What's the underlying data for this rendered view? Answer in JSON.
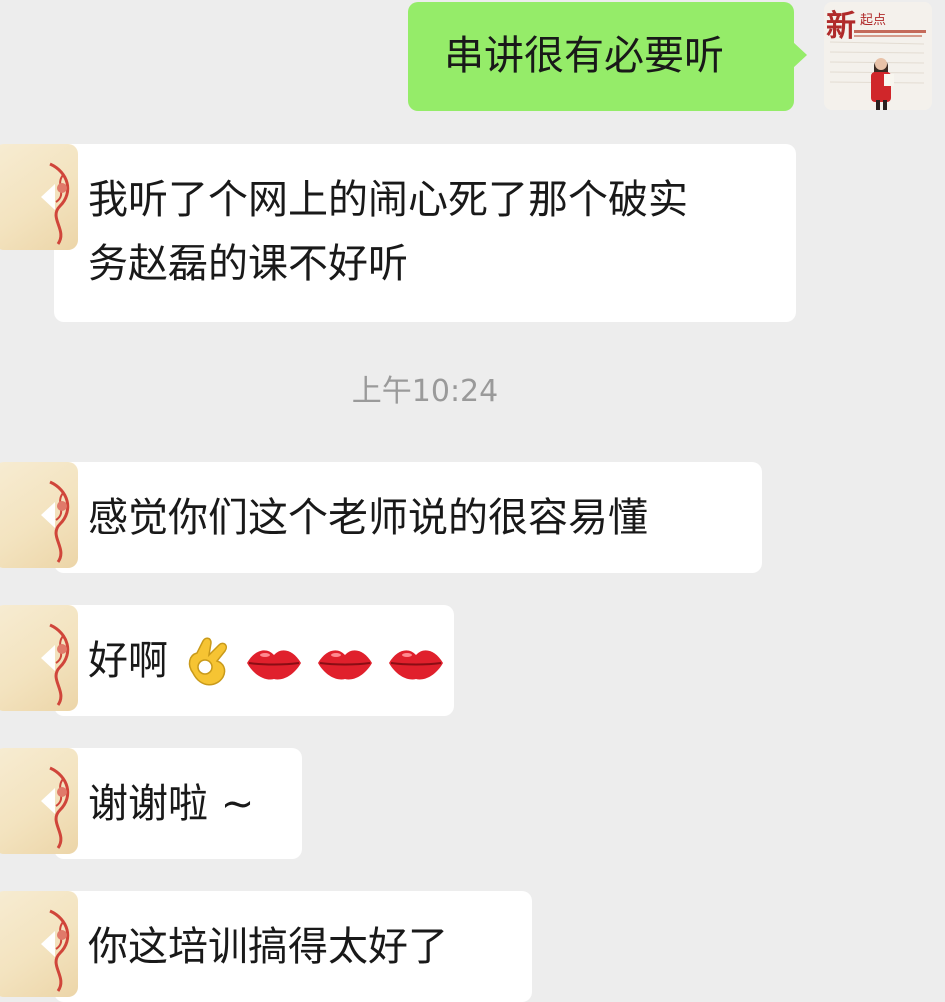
{
  "conversation": {
    "timestamp": "上午10:24",
    "messages": [
      {
        "sender": "self",
        "text": "串讲很有必要听"
      },
      {
        "sender": "contact",
        "text": "我听了个网上的闹心死了那个破实\n务赵磊的课不好听"
      },
      {
        "sender": "contact",
        "text": "感觉你们这个老师说的很容易懂"
      },
      {
        "sender": "contact",
        "text": "好啊",
        "emojis": [
          "ok-hand-emoji",
          "lips-emoji",
          "lips-emoji",
          "lips-emoji"
        ]
      },
      {
        "sender": "contact",
        "text": "谢谢啦 ~"
      },
      {
        "sender": "contact",
        "text": "你这培训搞得太好了"
      }
    ]
  },
  "colors": {
    "background": "#ededed",
    "incoming_bubble": "#ffffff",
    "outgoing_bubble": "#95ec69",
    "timestamp_text": "#9a9a9a",
    "message_text": "#191919"
  }
}
